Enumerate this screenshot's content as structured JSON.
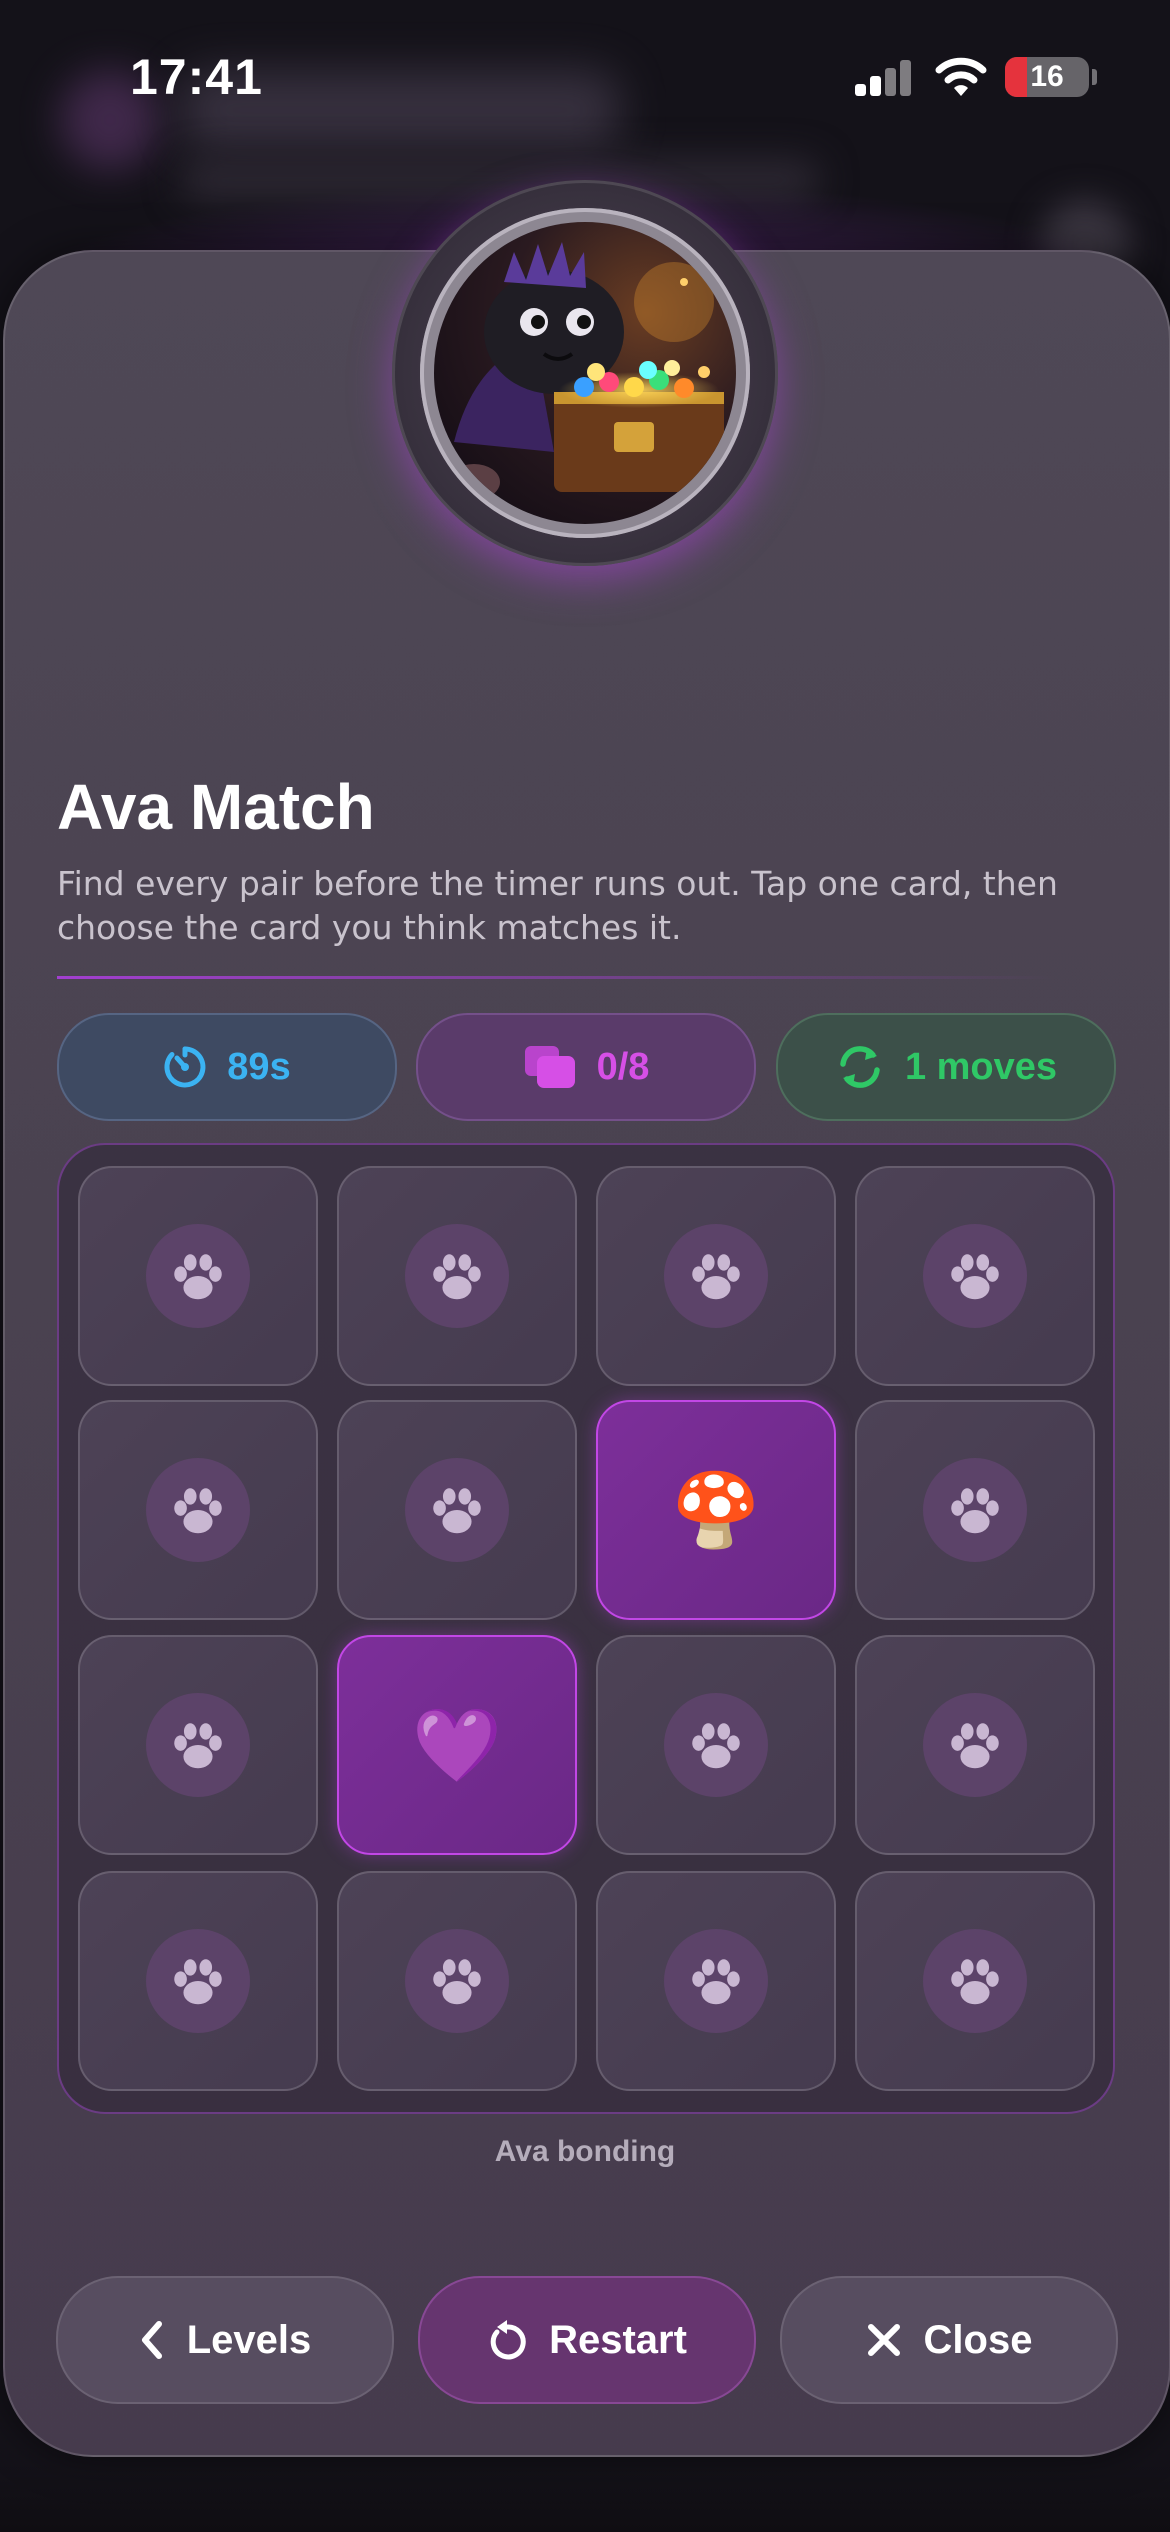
{
  "status_bar": {
    "time": "17:41",
    "battery": "16"
  },
  "game": {
    "title": "Ava Match",
    "description": "Find every pair before the timer runs out. Tap one card, then choose the card you think matches it.",
    "stats": {
      "timer": "89s",
      "pairs": "0/8",
      "moves": "1 moves"
    },
    "caption": "Ava bonding"
  },
  "cards": [
    {
      "state": "hidden",
      "icon": "paw-icon"
    },
    {
      "state": "hidden",
      "icon": "paw-icon"
    },
    {
      "state": "hidden",
      "icon": "paw-icon"
    },
    {
      "state": "hidden",
      "icon": "paw-icon"
    },
    {
      "state": "hidden",
      "icon": "paw-icon"
    },
    {
      "state": "hidden",
      "icon": "paw-icon"
    },
    {
      "state": "revealed",
      "face": "🍄"
    },
    {
      "state": "hidden",
      "icon": "paw-icon"
    },
    {
      "state": "hidden",
      "icon": "paw-icon"
    },
    {
      "state": "revealed",
      "face": "💜"
    },
    {
      "state": "hidden",
      "icon": "paw-icon"
    },
    {
      "state": "hidden",
      "icon": "paw-icon"
    },
    {
      "state": "hidden",
      "icon": "paw-icon"
    },
    {
      "state": "hidden",
      "icon": "paw-icon"
    },
    {
      "state": "hidden",
      "icon": "paw-icon"
    },
    {
      "state": "hidden",
      "icon": "paw-icon"
    }
  ],
  "buttons": {
    "levels": "Levels",
    "restart": "Restart",
    "close": "Close"
  },
  "colors": {
    "timer": "#3bb3f2",
    "pairs": "#d64fe6",
    "moves": "#2fc866",
    "accent": "#c247e6"
  }
}
